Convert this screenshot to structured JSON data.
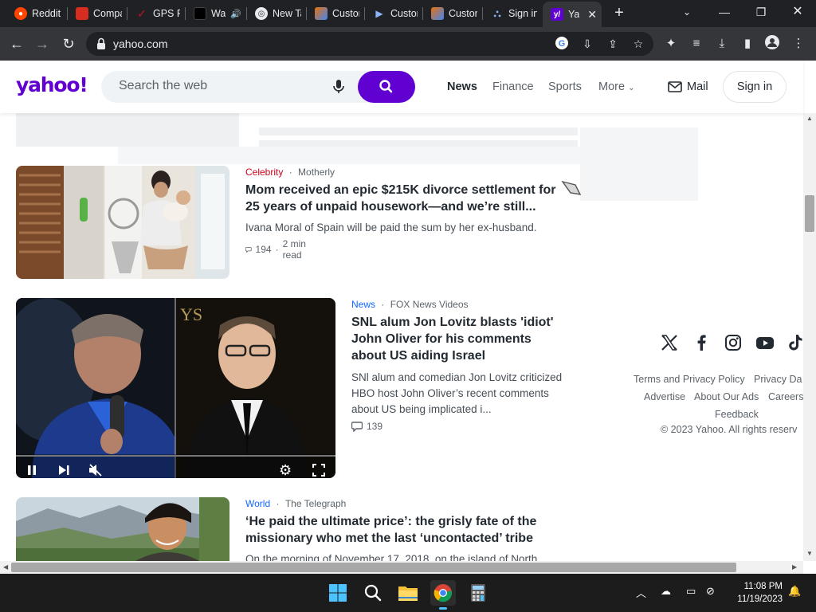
{
  "browser": {
    "tabs": [
      {
        "label": "Reddit",
        "icon": "reddit-icon",
        "color": "#ff4500"
      },
      {
        "label": "Compa",
        "icon": "compare-icon",
        "color": "#d62d20"
      },
      {
        "label": "GPS Fl",
        "icon": "gps-icon",
        "color": "#c8102e"
      },
      {
        "label": "Wa",
        "icon": "video-icon",
        "color": "#000000"
      },
      {
        "label": "New Ta",
        "icon": "chrome-newtab-icon",
        "color": "#5f6368"
      },
      {
        "label": "Custor",
        "icon": "custom-icon",
        "color": "#e8710a"
      },
      {
        "label": "Custor",
        "icon": "custom-play-icon",
        "color": "#4285f4"
      },
      {
        "label": "Custor",
        "icon": "custom-icon",
        "color": "#e8710a"
      },
      {
        "label": "Sign in",
        "icon": "signin-icon",
        "color": "#1a73e8"
      },
      {
        "label": "Yal",
        "icon": "yahoo-icon",
        "color": "#6001d2"
      }
    ],
    "url": "yahoo.com"
  },
  "yahoo": {
    "logo": "yahoo!",
    "search_placeholder": "Search the web",
    "nav": [
      "News",
      "Finance",
      "Sports",
      "More"
    ],
    "mail": "Mail",
    "signin": "Sign in",
    "brand_color": "#6001d2"
  },
  "stories": [
    {
      "category": "Celebrity",
      "category_color": "#d0021b",
      "source": "Motherly",
      "headline": "Mom received an epic $215K divorce settlement for 25 years of unpaid housework—and we’re still...",
      "summary": "Ivana Moral of Spain will be paid the sum by her ex-husband.",
      "comments": "194",
      "read_time": "2 min read"
    },
    {
      "category": "News",
      "category_color": "#0f69ff",
      "source": "FOX News Videos",
      "headline": "SNL alum Jon Lovitz blasts 'idiot' John Oliver for his comments about US aiding Israel",
      "summary": "SNl alum and comedian Jon Lovitz criticized HBO host John Oliver’s recent comments about US being implicated i...",
      "comments": "139",
      "video_overlay_text": "YS"
    },
    {
      "category": "World",
      "category_color": "#0f69ff",
      "source": "The Telegraph",
      "headline": "‘He paid the ultimate price’: the grisly fate of the missionary who met the last ‘uncontacted’ tribe",
      "summary": "On the morning of November 17, 2018, on the island of North"
    }
  ],
  "footer": {
    "social": [
      "x-icon",
      "facebook-icon",
      "instagram-icon",
      "youtube-icon",
      "tiktok-icon"
    ],
    "links": [
      "Terms and Privacy Policy",
      "Privacy Da",
      "Advertise",
      "About Our Ads",
      "Careers",
      "Feedback"
    ],
    "copyright": "© 2023 Yahoo. All rights reserv"
  },
  "taskbar": {
    "time": "11:08 PM",
    "date": "11/19/2023"
  }
}
